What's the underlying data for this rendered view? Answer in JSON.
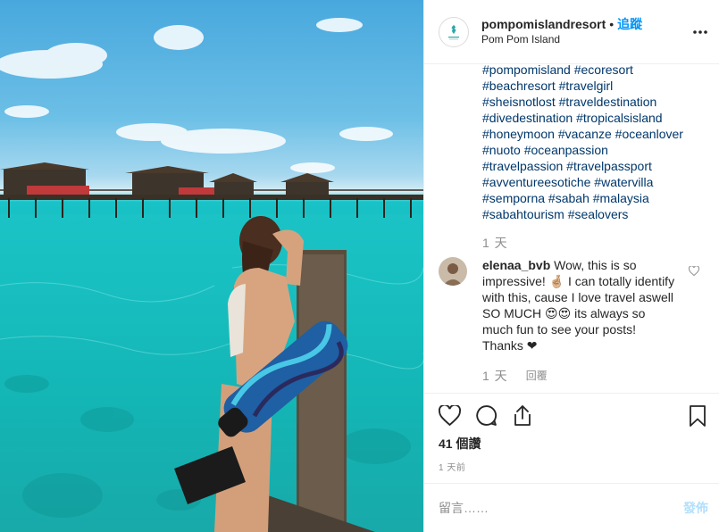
{
  "post": {
    "username": "pompomislandresort",
    "separator": "•",
    "follow_label": "追蹤",
    "location": "Pom Pom Island",
    "caption_hashtags": [
      "#pompomisland #ecoresort",
      "#beachresort #travelgirl",
      "#sheisnotlost #traveldestination",
      "#divedestination #tropicalsisland",
      "#honeymoon #vacanze #oceanlover",
      "#nuoto #oceanpassion",
      "#travelpassion #travelpassport",
      "#avventureesotiche #watervilla",
      "#semporna #sabah #malaysia",
      "#sabahtourism #sealovers"
    ],
    "caption_time": "1 天",
    "comment": {
      "username": "elenaa_bvb",
      "text": "Wow, this is so impressive! 🤞🏼 I can totally identify with this, cause I love travel aswell SO MUCH 😍😍 its always so much fun to see your posts! Thanks ❤",
      "time": "1 天",
      "reply_label": "回覆"
    },
    "views": "41 個讚",
    "date": "1 天前",
    "comment_placeholder": "留言……",
    "post_label": "發佈"
  },
  "icons": {
    "more": "more-options-icon",
    "like": "heart-icon",
    "comment": "comment-icon",
    "share": "share-icon",
    "save": "bookmark-icon"
  },
  "colors": {
    "link": "#00376b",
    "follow": "#0095f6",
    "muted": "#8e8e8e",
    "post_button_disabled": "#b2dffc"
  }
}
